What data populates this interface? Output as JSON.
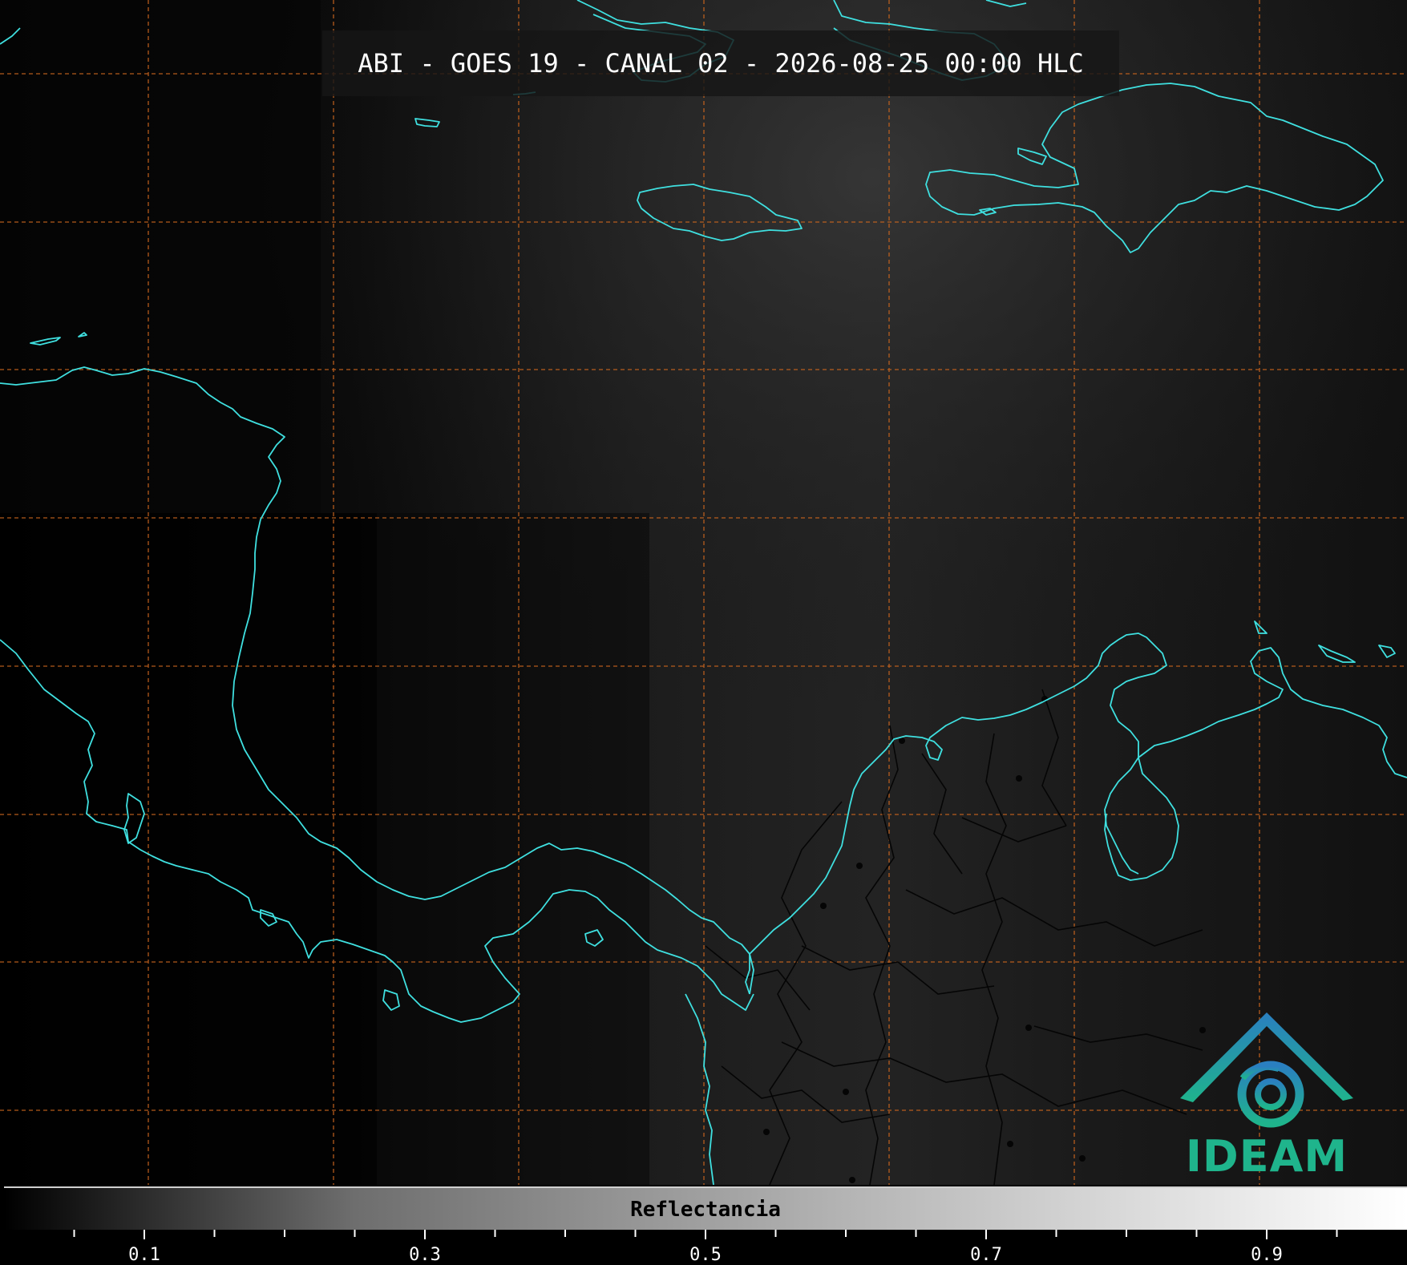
{
  "title": "ABI - GOES 19 - CANAL 02 - 2026-08-25 00:00 HLC",
  "colorbar": {
    "label": "Reflectancia",
    "range": [
      0.0,
      1.0
    ],
    "major_ticks": [
      "0.1",
      "0.3",
      "0.5",
      "0.7",
      "0.9"
    ],
    "colormap": "grayscale (black to white)"
  },
  "logo": {
    "text": "IDEAM",
    "colors": [
      "#2a7fc0",
      "#1fb48c"
    ]
  },
  "map": {
    "background_color": "#0f0f0f",
    "coastline_color": "#3fe0e0",
    "border_color": "#050505",
    "gridline_color": "#c8641e",
    "gridline_style": "dashed",
    "layers": [
      "coastlines",
      "graticule",
      "internal borders",
      "city markers"
    ]
  }
}
